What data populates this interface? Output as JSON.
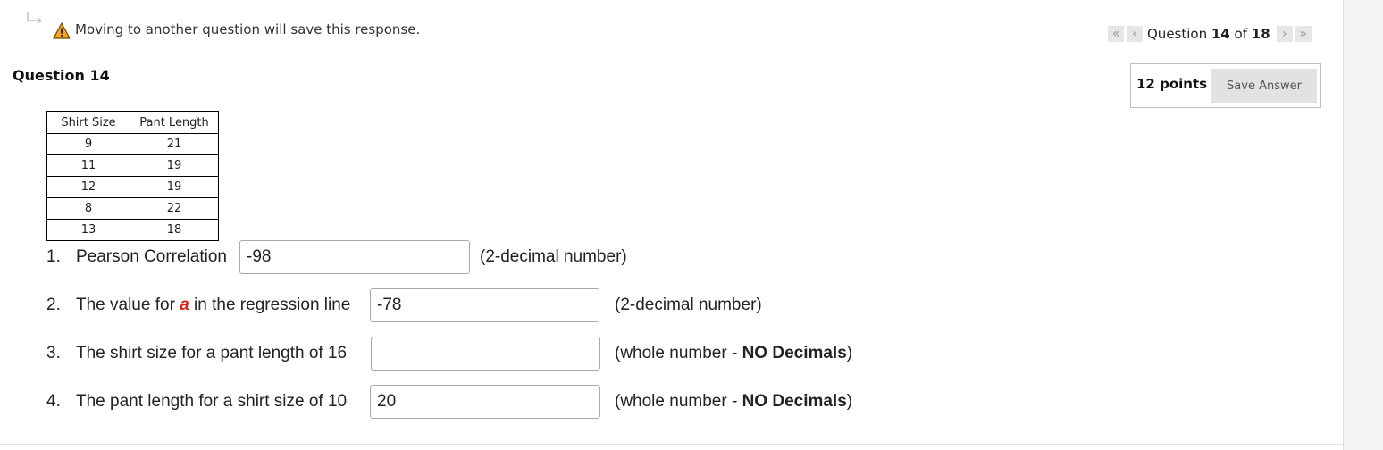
{
  "header": {
    "warning_text": "Moving to another question will save this response."
  },
  "nav": {
    "prefix": "Question",
    "current": "14",
    "of": "of",
    "total": "18",
    "first_icon": "double-chevron-left-icon",
    "prev_icon": "chevron-left-icon",
    "next_icon": "chevron-right-icon",
    "last_icon": "double-chevron-right-icon"
  },
  "question": {
    "title": "Question 14",
    "points": "12 points",
    "save_label": "Save Answer"
  },
  "table": {
    "headers": [
      "Shirt Size",
      "Pant Length"
    ],
    "rows": [
      [
        "9",
        "21"
      ],
      [
        "11",
        "19"
      ],
      [
        "12",
        "19"
      ],
      [
        "8",
        "22"
      ],
      [
        "13",
        "18"
      ]
    ]
  },
  "items": [
    {
      "num": "1.",
      "text": "Pearson Correlation",
      "value": "-98",
      "hint": "(2-decimal number)"
    },
    {
      "num": "2.",
      "text_before": "The value for",
      "variable": "a",
      "text_after": "in the regression line",
      "value": "-78",
      "hint": "(2-decimal number)"
    },
    {
      "num": "3.",
      "text": "The shirt size for a pant length of 16",
      "value": "",
      "hint_before": "(whole number -",
      "hint_bold": "NO Decimals",
      "hint_after": ")"
    },
    {
      "num": "4.",
      "text": "The pant length for a shirt size of 10",
      "value": "20",
      "hint_before": "(whole number -",
      "hint_bold": "NO Decimals",
      "hint_after": ")"
    }
  ],
  "colors": {
    "accent_red": "#d9231d",
    "warning_yellow": "#f5a623"
  }
}
